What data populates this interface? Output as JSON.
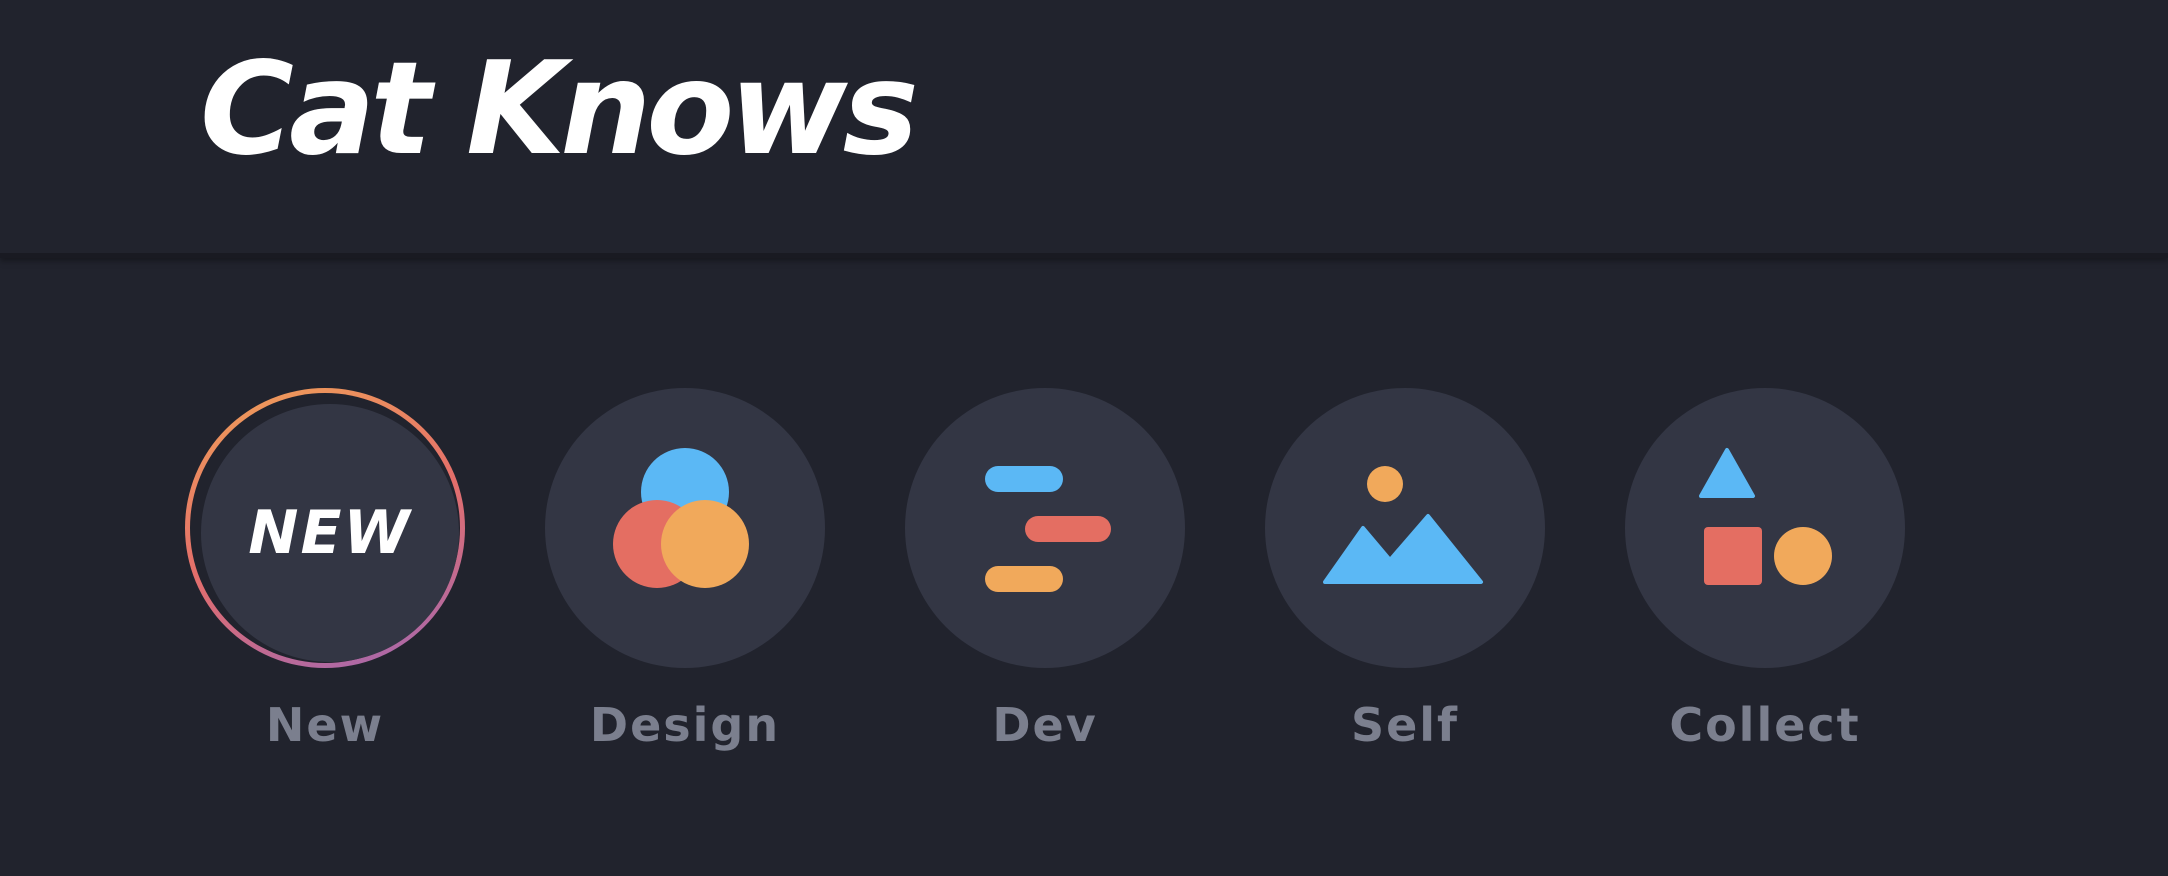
{
  "header": {
    "logo_text": "Cat Knows"
  },
  "categories": [
    {
      "label": "New",
      "badge_text": "NEW",
      "icon": "new-badge-icon"
    },
    {
      "label": "Design",
      "icon": "overlapping-circles-icon"
    },
    {
      "label": "Dev",
      "icon": "code-bars-icon"
    },
    {
      "label": "Self",
      "icon": "mountain-sun-icon"
    },
    {
      "label": "Collect",
      "icon": "shapes-icon"
    }
  ],
  "colors": {
    "background": "#21232d",
    "circle": "#333644",
    "label": "#7b7f8e",
    "blue": "#5bb8f5",
    "red": "#e46e62",
    "orange": "#f1a95b",
    "ring_gradient": [
      "#f0a157",
      "#e46e6b",
      "#a067b5"
    ]
  }
}
